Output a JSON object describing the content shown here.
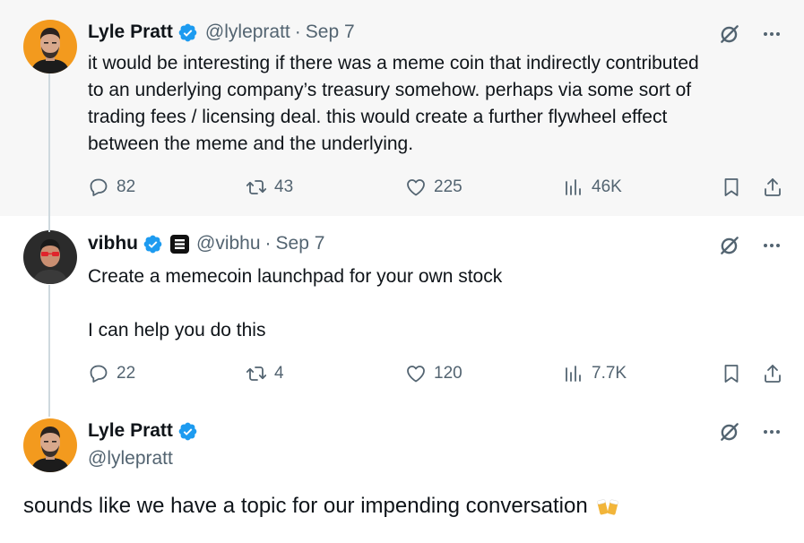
{
  "tweets": [
    {
      "author": "Lyle Pratt",
      "handle": "@lylepratt",
      "date": "Sep 7",
      "text_lines": [
        "it would be interesting if there was a meme coin that indirectly contributed",
        "to an underlying company’s treasury somehow. perhaps via some sort of",
        "trading fees / licensing deal. this would create a further flywheel effect",
        "between the meme and the underlying."
      ],
      "replies": "82",
      "reposts": "43",
      "likes": "225",
      "views": "46K"
    },
    {
      "author": "vibhu",
      "handle": "@vibhu",
      "date": "Sep 7",
      "text_lines": [
        "Create a memecoin launchpad for your own stock",
        "",
        "I can help you do this"
      ],
      "replies": "22",
      "reposts": "4",
      "likes": "120",
      "views": "7.7K"
    },
    {
      "author": "Lyle Pratt",
      "handle": "@lylepratt",
      "text": "sounds like we have a topic for our impending conversation"
    }
  ],
  "separator": "·",
  "colors": {
    "verified": "#1d9bf0",
    "muted": "#536471",
    "text": "#0f1419",
    "highlight_bg": "#f7f7f7",
    "thread_line": "#cfd9de"
  },
  "icons": {
    "verified": "verified-badge-icon",
    "grok": "grok-icon",
    "more": "more-dots-icon",
    "reply": "reply-bubble-icon",
    "repost": "repost-arrows-icon",
    "like": "heart-icon",
    "views": "views-bars-icon",
    "bookmark": "bookmark-icon",
    "share": "share-upload-icon",
    "emoji": "clinking-beer-mugs-emoji"
  }
}
